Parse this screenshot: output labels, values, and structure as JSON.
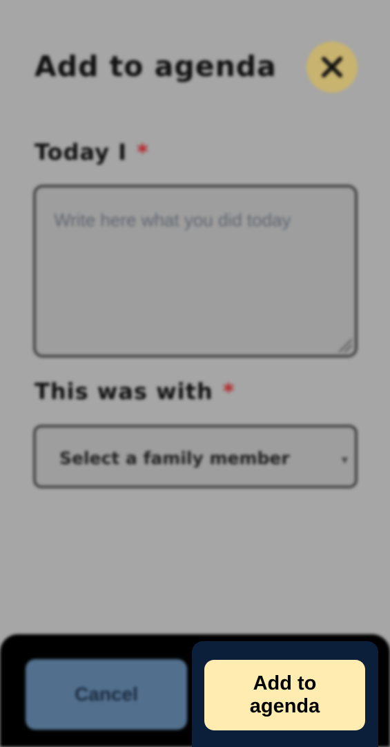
{
  "dialog": {
    "title": "Add to agenda",
    "close_icon": "close-icon"
  },
  "fields": {
    "today": {
      "label": "Today I",
      "required_mark": "*",
      "value": "",
      "placeholder": "Write here what you did today"
    },
    "with": {
      "label": "This was with",
      "required_mark": "*",
      "selected": "Select a family member",
      "chevron_icon": "chevron-down-icon"
    }
  },
  "footer": {
    "cancel_label": "Cancel",
    "add_label": "Add to agenda"
  },
  "colors": {
    "overlay": "#a6a6a6",
    "close_button": "#c8b36f",
    "required": "#b3272a",
    "cancel_button": "#52708e",
    "primary_button": "#ffecb0",
    "primary_focus_ring": "#0b1f3a"
  }
}
